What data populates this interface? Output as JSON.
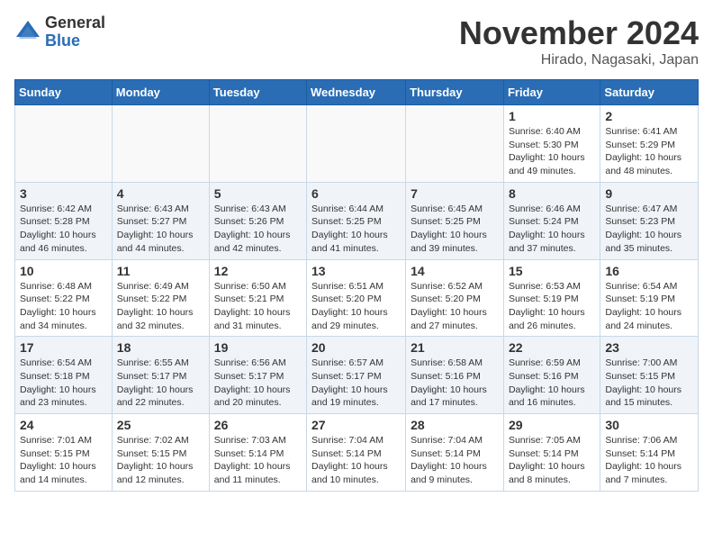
{
  "logo": {
    "general": "General",
    "blue": "Blue"
  },
  "title": "November 2024",
  "location": "Hirado, Nagasaki, Japan",
  "weekdays": [
    "Sunday",
    "Monday",
    "Tuesday",
    "Wednesday",
    "Thursday",
    "Friday",
    "Saturday"
  ],
  "weeks": [
    [
      {
        "day": "",
        "info": ""
      },
      {
        "day": "",
        "info": ""
      },
      {
        "day": "",
        "info": ""
      },
      {
        "day": "",
        "info": ""
      },
      {
        "day": "",
        "info": ""
      },
      {
        "day": "1",
        "info": "Sunrise: 6:40 AM\nSunset: 5:30 PM\nDaylight: 10 hours and 49 minutes."
      },
      {
        "day": "2",
        "info": "Sunrise: 6:41 AM\nSunset: 5:29 PM\nDaylight: 10 hours and 48 minutes."
      }
    ],
    [
      {
        "day": "3",
        "info": "Sunrise: 6:42 AM\nSunset: 5:28 PM\nDaylight: 10 hours and 46 minutes."
      },
      {
        "day": "4",
        "info": "Sunrise: 6:43 AM\nSunset: 5:27 PM\nDaylight: 10 hours and 44 minutes."
      },
      {
        "day": "5",
        "info": "Sunrise: 6:43 AM\nSunset: 5:26 PM\nDaylight: 10 hours and 42 minutes."
      },
      {
        "day": "6",
        "info": "Sunrise: 6:44 AM\nSunset: 5:25 PM\nDaylight: 10 hours and 41 minutes."
      },
      {
        "day": "7",
        "info": "Sunrise: 6:45 AM\nSunset: 5:25 PM\nDaylight: 10 hours and 39 minutes."
      },
      {
        "day": "8",
        "info": "Sunrise: 6:46 AM\nSunset: 5:24 PM\nDaylight: 10 hours and 37 minutes."
      },
      {
        "day": "9",
        "info": "Sunrise: 6:47 AM\nSunset: 5:23 PM\nDaylight: 10 hours and 35 minutes."
      }
    ],
    [
      {
        "day": "10",
        "info": "Sunrise: 6:48 AM\nSunset: 5:22 PM\nDaylight: 10 hours and 34 minutes."
      },
      {
        "day": "11",
        "info": "Sunrise: 6:49 AM\nSunset: 5:22 PM\nDaylight: 10 hours and 32 minutes."
      },
      {
        "day": "12",
        "info": "Sunrise: 6:50 AM\nSunset: 5:21 PM\nDaylight: 10 hours and 31 minutes."
      },
      {
        "day": "13",
        "info": "Sunrise: 6:51 AM\nSunset: 5:20 PM\nDaylight: 10 hours and 29 minutes."
      },
      {
        "day": "14",
        "info": "Sunrise: 6:52 AM\nSunset: 5:20 PM\nDaylight: 10 hours and 27 minutes."
      },
      {
        "day": "15",
        "info": "Sunrise: 6:53 AM\nSunset: 5:19 PM\nDaylight: 10 hours and 26 minutes."
      },
      {
        "day": "16",
        "info": "Sunrise: 6:54 AM\nSunset: 5:19 PM\nDaylight: 10 hours and 24 minutes."
      }
    ],
    [
      {
        "day": "17",
        "info": "Sunrise: 6:54 AM\nSunset: 5:18 PM\nDaylight: 10 hours and 23 minutes."
      },
      {
        "day": "18",
        "info": "Sunrise: 6:55 AM\nSunset: 5:17 PM\nDaylight: 10 hours and 22 minutes."
      },
      {
        "day": "19",
        "info": "Sunrise: 6:56 AM\nSunset: 5:17 PM\nDaylight: 10 hours and 20 minutes."
      },
      {
        "day": "20",
        "info": "Sunrise: 6:57 AM\nSunset: 5:17 PM\nDaylight: 10 hours and 19 minutes."
      },
      {
        "day": "21",
        "info": "Sunrise: 6:58 AM\nSunset: 5:16 PM\nDaylight: 10 hours and 17 minutes."
      },
      {
        "day": "22",
        "info": "Sunrise: 6:59 AM\nSunset: 5:16 PM\nDaylight: 10 hours and 16 minutes."
      },
      {
        "day": "23",
        "info": "Sunrise: 7:00 AM\nSunset: 5:15 PM\nDaylight: 10 hours and 15 minutes."
      }
    ],
    [
      {
        "day": "24",
        "info": "Sunrise: 7:01 AM\nSunset: 5:15 PM\nDaylight: 10 hours and 14 minutes."
      },
      {
        "day": "25",
        "info": "Sunrise: 7:02 AM\nSunset: 5:15 PM\nDaylight: 10 hours and 12 minutes."
      },
      {
        "day": "26",
        "info": "Sunrise: 7:03 AM\nSunset: 5:14 PM\nDaylight: 10 hours and 11 minutes."
      },
      {
        "day": "27",
        "info": "Sunrise: 7:04 AM\nSunset: 5:14 PM\nDaylight: 10 hours and 10 minutes."
      },
      {
        "day": "28",
        "info": "Sunrise: 7:04 AM\nSunset: 5:14 PM\nDaylight: 10 hours and 9 minutes."
      },
      {
        "day": "29",
        "info": "Sunrise: 7:05 AM\nSunset: 5:14 PM\nDaylight: 10 hours and 8 minutes."
      },
      {
        "day": "30",
        "info": "Sunrise: 7:06 AM\nSunset: 5:14 PM\nDaylight: 10 hours and 7 minutes."
      }
    ]
  ]
}
